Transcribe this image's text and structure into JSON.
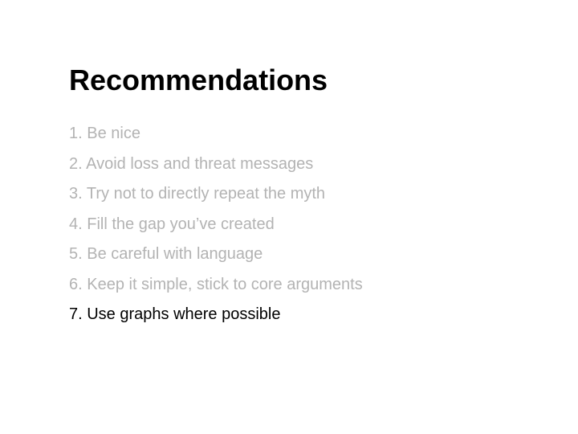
{
  "slide": {
    "title": "Recommendations",
    "items": [
      {
        "text": "1. Be nice",
        "state": "dim"
      },
      {
        "text": "2. Avoid loss and threat messages",
        "state": "dim"
      },
      {
        "text": "3. Try not to directly repeat the myth",
        "state": "dim"
      },
      {
        "text": "4. Fill the gap you’ve created",
        "state": "dim"
      },
      {
        "text": "5. Be careful with language",
        "state": "dim"
      },
      {
        "text": "6. Keep it simple, stick to core arguments",
        "state": "dim"
      },
      {
        "text": "7. Use graphs where possible",
        "state": "active"
      }
    ],
    "colors": {
      "dim_text": "#b3b3b3",
      "active_text": "#000000",
      "background": "#ffffff"
    }
  }
}
